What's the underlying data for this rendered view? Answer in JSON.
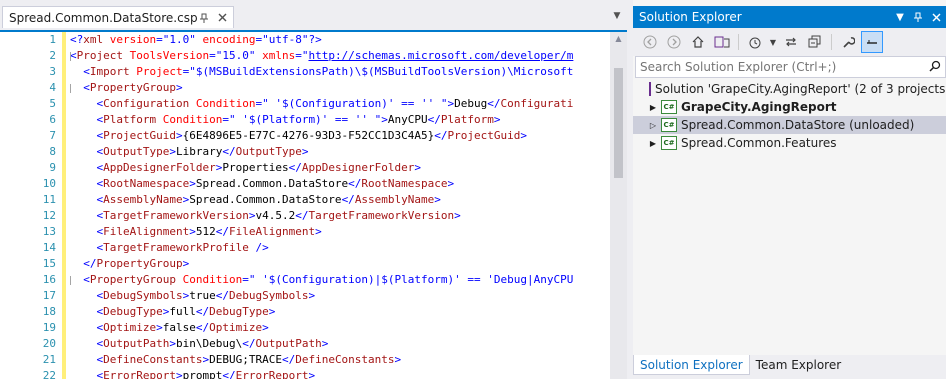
{
  "editor": {
    "tab_title": "Spread.Common.DataStore.csproj*",
    "pin_glyph": "⊕",
    "close_glyph": "✕",
    "line_numbers": [
      "1",
      "2",
      "3",
      "4",
      "5",
      "6",
      "7",
      "8",
      "9",
      "10",
      "11",
      "12",
      "13",
      "14",
      "15",
      "16",
      "17",
      "18",
      "19",
      "20",
      "21",
      "22"
    ],
    "lines": [
      "<?xml version=\"1.0\" encoding=\"utf-8\"?>",
      "<Project ToolsVersion=\"15.0\" xmlns=\"http://schemas.microsoft.com/developer/m",
      "  <Import Project=\"$(MSBuildExtensionsPath)\\$(MSBuildToolsVersion)\\Microsoft",
      "  <PropertyGroup>",
      "    <Configuration Condition=\" '$(Configuration)' == '' \">Debug</Configurati",
      "    <Platform Condition=\" '$(Platform)' == '' \">AnyCPU</Platform>",
      "    <ProjectGuid>{6E4896E5-E77C-4276-93D3-F52CC1D3C4A5}</ProjectGuid>",
      "    <OutputType>Library</OutputType>",
      "    <AppDesignerFolder>Properties</AppDesignerFolder>",
      "    <RootNamespace>Spread.Common.DataStore</RootNamespace>",
      "    <AssemblyName>Spread.Common.DataStore</AssemblyName>",
      "    <TargetFrameworkVersion>v4.5.2</TargetFrameworkVersion>",
      "    <FileAlignment>512</FileAlignment>",
      "    <TargetFrameworkProfile />",
      "  </PropertyGroup>",
      "  <PropertyGroup Condition=\" '$(Configuration)|$(Platform)' == 'Debug|AnyCPU",
      "    <DebugSymbols>true</DebugSymbols>",
      "    <DebugType>full</DebugType>",
      "    <Optimize>false</Optimize>",
      "    <OutputPath>bin\\Debug\\</OutputPath>",
      "    <DefineConstants>DEBUG;TRACE</DefineConstants>",
      "    <ErrorReport>prompt</ErrorReport>"
    ],
    "fold_lines": [
      2,
      4,
      16
    ],
    "colors": {
      "accent": "#007acc",
      "changebar": "#ffef7a",
      "line_number": "#2b91af"
    }
  },
  "solution_explorer": {
    "title": "Solution Explorer",
    "title_buttons": [
      "dropdown-icon",
      "pin-icon",
      "close-icon"
    ],
    "search_placeholder": "Search Solution Explorer (Ctrl+;)",
    "tree": [
      {
        "label": "Solution 'GrapeCity.AgingReport' (2 of 3 projects)",
        "icon": "solution-icon",
        "bold": false,
        "expander": ""
      },
      {
        "label": "GrapeCity.AgingReport",
        "icon": "csharp-project-icon",
        "bold": true,
        "expander": "▶"
      },
      {
        "label": "Spread.Common.DataStore (unloaded)",
        "icon": "csharp-project-icon",
        "bold": false,
        "expander": "▷",
        "selected": true
      },
      {
        "label": "Spread.Common.Features",
        "icon": "csharp-project-icon",
        "bold": false,
        "expander": "▶"
      }
    ],
    "tabs": [
      "Solution Explorer",
      "Team Explorer"
    ],
    "active_tab": "Solution Explorer"
  }
}
